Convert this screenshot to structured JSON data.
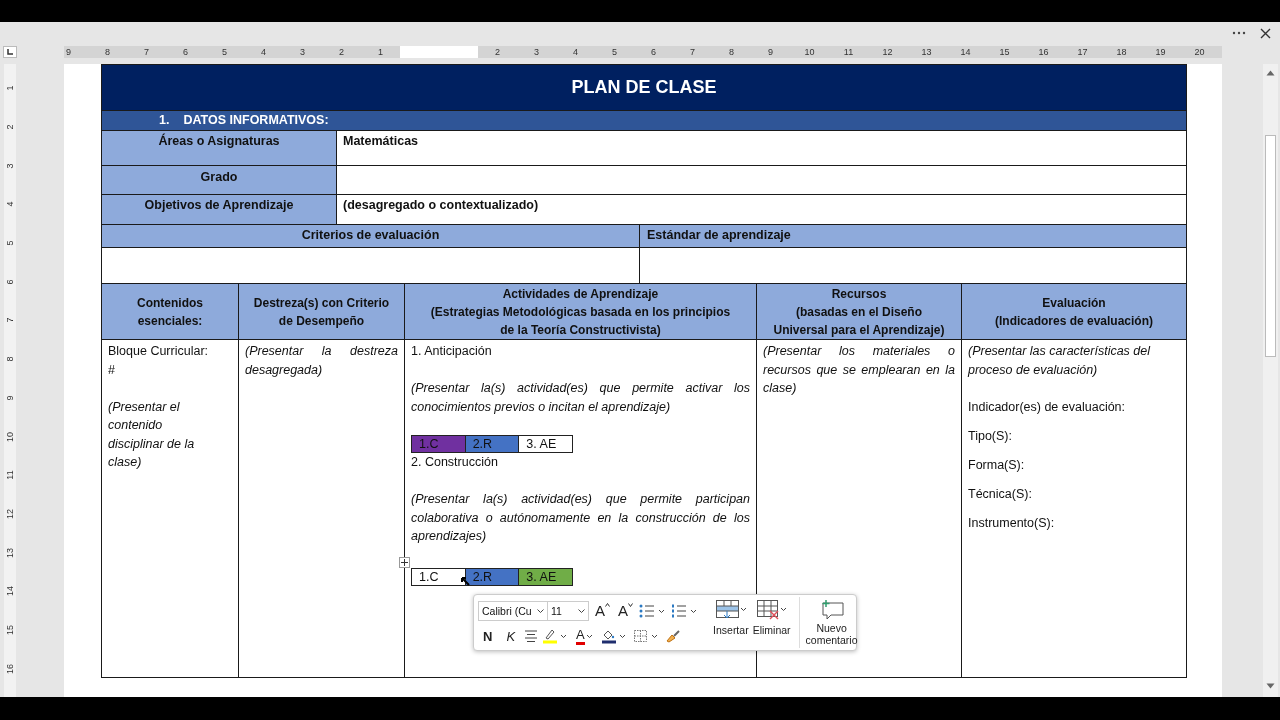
{
  "ruler": {
    "left_labels": [
      "9",
      "8",
      "7",
      "6",
      "5",
      "4",
      "3",
      "2",
      "1"
    ],
    "right_labels": [
      "2",
      "3",
      "4",
      "5",
      "6",
      "7",
      "8",
      "9",
      "10",
      "11",
      "12",
      "13",
      "14",
      "15",
      "16",
      "17",
      "18",
      "19",
      "20"
    ]
  },
  "vertical_ruler": {
    "labels": [
      "1",
      "2",
      "3",
      "4",
      "5",
      "6",
      "7",
      "8",
      "9",
      "10",
      "11",
      "12",
      "13",
      "14",
      "15",
      "16"
    ]
  },
  "document": {
    "title": "PLAN DE CLASE",
    "section": {
      "number": "1.",
      "heading": "DATOS INFORMATIVOS:"
    },
    "info_rows": [
      {
        "label": "Áreas o Asignaturas",
        "value": "Matemáticas"
      },
      {
        "label": "Grado"
      },
      {
        "label": "Objetivos de Aprendizaje",
        "value": "(desagregado o contextualizado)"
      }
    ],
    "criteria_headers": [
      "Criterios de evaluación",
      "Estándar de aprendizaje"
    ],
    "plan": {
      "columns": [
        "Contenidos\nesenciales:",
        "Destreza(s) con Criterio\nde Desempeño",
        "Actividades de Aprendizaje\n(Estrategias Metodológicas basada en los principios\nde la Teoría Constructivista)",
        "Recursos\n(basadas en el Diseño\nUniversal para el Aprendizaje)",
        "Evaluación\n(Indicadores de evaluación)"
      ],
      "contents": {
        "block": "Bloque Curricular:\n#",
        "description": "(Presentar el contenido disciplinar de la clase)"
      },
      "skill": "(Presentar la destreza desagregada)",
      "activities": {
        "sections": [
          {
            "title": "1. Anticipación",
            "description": "(Presentar la(s) actividad(es) que permite activar los conocimientos previos o incitan el aprendizaje)",
            "codes": [
              {
                "label": "1.C",
                "color": "#7030a0"
              },
              {
                "label": "2.R",
                "color": "#4472c4"
              },
              {
                "label": "3. AE",
                "color": "#ffffff"
              }
            ]
          },
          {
            "title": "2. Construcción",
            "description": "(Presentar la(s) actividad(es) que permite participan colaborativa o autónomamente en la construcción de los aprendizajes)",
            "codes": [
              {
                "label": "1.C",
                "color": "#ffffff"
              },
              {
                "label": "2.R",
                "color": "#4472c4"
              },
              {
                "label": "3. AE",
                "color": "#70ad47"
              }
            ]
          }
        ]
      },
      "resources": "(Presentar los materiales o recursos que se emplearan en la clase)",
      "evaluation": {
        "description": "(Presentar las características del proceso de evaluación)",
        "fields": [
          "Indicador(es) de evaluación:",
          "Tipo(S):",
          "Forma(S):",
          "Técnica(S):",
          "Instrumento(S):"
        ]
      }
    }
  },
  "mini_toolbar": {
    "font": "Calibri (Cu",
    "size": "11",
    "grow_label": "A",
    "shrink_label": "A",
    "bold_label": "N",
    "italic_label": "K",
    "font_color_label": "A",
    "buttons": [
      {
        "kind": "insert",
        "label": "Insertar"
      },
      {
        "kind": "delete",
        "label": "Eliminar"
      },
      {
        "kind": "comment",
        "label": "Nuevo\ncomentario"
      }
    ]
  }
}
